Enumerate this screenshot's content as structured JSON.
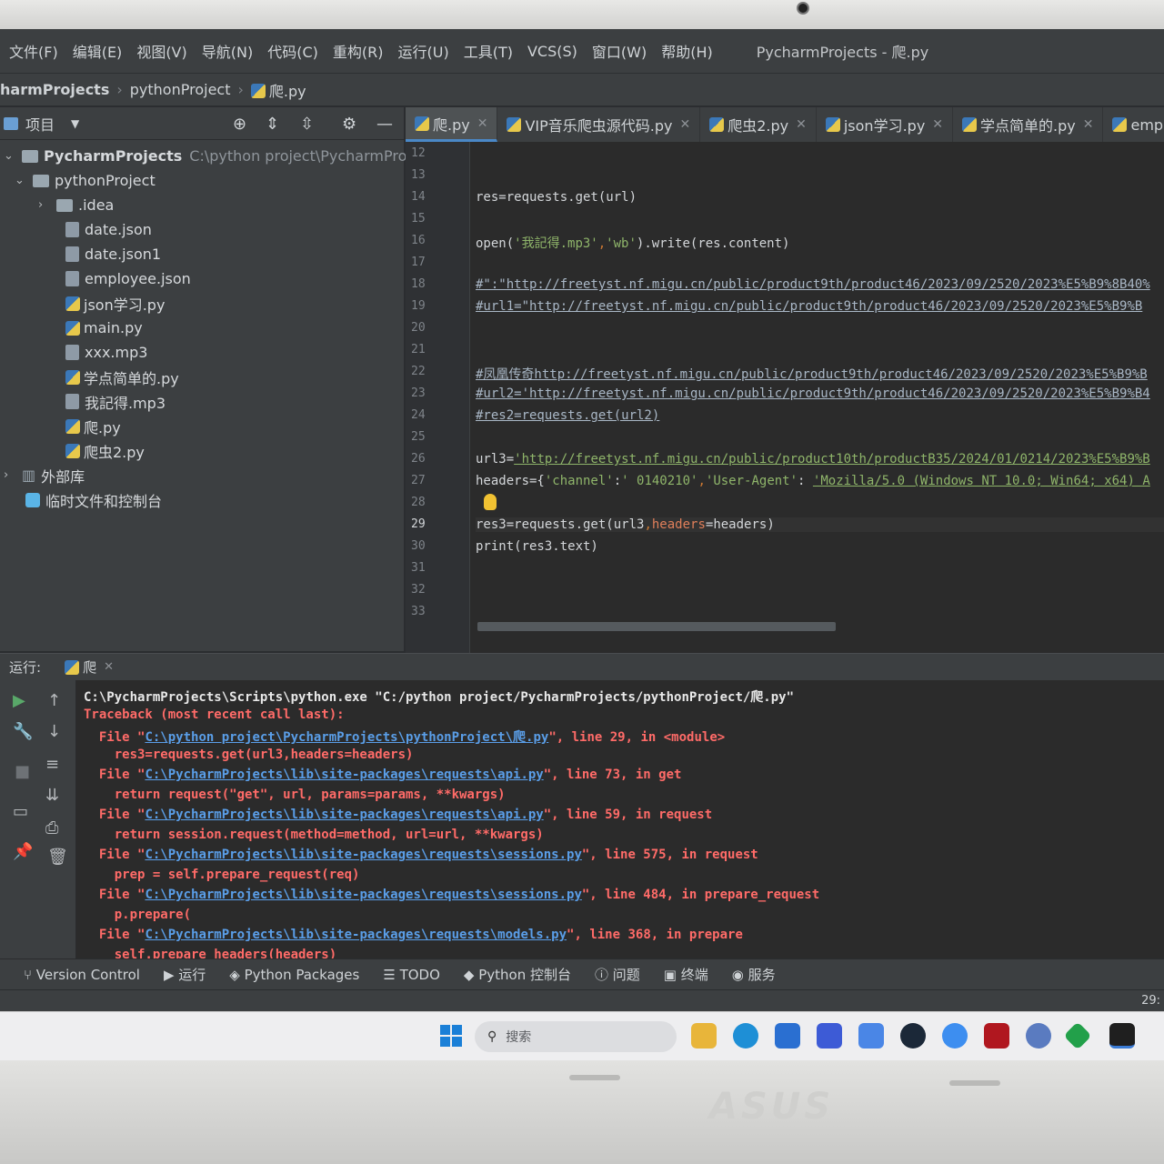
{
  "menu": {
    "items": [
      "文件(F)",
      "编辑(E)",
      "视图(V)",
      "导航(N)",
      "代码(C)",
      "重构(R)",
      "运行(U)",
      "工具(T)",
      "VCS(S)",
      "窗口(W)",
      "帮助(H)"
    ],
    "window_title": "PycharmProjects - 爬.py"
  },
  "breadcrumb": [
    "harmProjects",
    "pythonProject",
    "爬.py"
  ],
  "project_panel": {
    "title": "项目",
    "root_name": "PycharmProjects",
    "root_path": "C:\\python project\\PycharmProjects",
    "folder": "pythonProject",
    "subfolder": ".idea",
    "files": [
      "date.json",
      "date.json1",
      "employee.json",
      "json学习.py",
      "main.py",
      "xxx.mp3",
      "学点简单的.py",
      "我記得.mp3",
      "爬.py",
      "爬虫2.py"
    ],
    "external_libs": "外部库",
    "scratches": "临时文件和控制台"
  },
  "editor_tabs": [
    "爬.py",
    "VIP音乐爬虫源代码.py",
    "爬虫2.py",
    "json学习.py",
    "学点简单的.py",
    "employ"
  ],
  "line_numbers": [
    "12",
    "13",
    "14",
    "15",
    "16",
    "17",
    "18",
    "19",
    "20",
    "21",
    "22",
    "23",
    "24",
    "25",
    "26",
    "27",
    "28",
    "29",
    "30",
    "31",
    "32",
    "33"
  ],
  "current_line": "29",
  "code": {
    "l14": "res=requests.get(url)",
    "l16a": "open(",
    "l16b": "'我記得.mp3'",
    "l16c": ",",
    "l16d": "'wb'",
    "l16e": ").write(res.content)",
    "l18": "#\":\"http://freetyst.nf.migu.cn/public/product9th/product46/2023/09/2520/2023%E5%B9%8B40%",
    "l19": "#url1=\"http://freetyst.nf.migu.cn/public/product9th/product46/2023/09/2520/2023%E5%B9%B",
    "l22": "#凤凰传奇http://freetyst.nf.migu.cn/public/product9th/product46/2023/09/2520/2023%E5%B9%B",
    "l23": "#url2='http://freetyst.nf.migu.cn/public/product9th/product46/2023/09/2520/2023%E5%B9%B4",
    "l24": "#res2=requests.get(url2)",
    "l26a": "url3=",
    "l26b": "'http://freetyst.nf.migu.cn/public/product10th/productB35/2024/01/0214/2023%E5%B9%B",
    "l27a": "headers={",
    "l27b": "'channel'",
    "l27c": ":",
    "l27d": "' 0140210'",
    "l27e": ",",
    "l27f": "'User-Agent'",
    "l27g": ": ",
    "l27h": "'Mozilla/5.0 (Windows NT 10.0; Win64; x64) A",
    "l29a": "res3=requests.get(url3",
    "l29b": ",",
    "l29c": "headers",
    "l29d": "=headers)",
    "l30": "print(res3.text)"
  },
  "run_panel": {
    "label": "运行:",
    "tab": "爬",
    "lines": [
      {
        "kind": "plain",
        "text": "C:\\PycharmProjects\\Scripts\\python.exe \"C:/python project/PycharmProjects/pythonProject/爬.py\""
      },
      {
        "kind": "err",
        "text": "Traceback (most recent call last):"
      },
      {
        "kind": "file",
        "pre": "  File \"",
        "link": "C:\\python project\\PycharmProjects\\pythonProject\\爬.py",
        "post": "\", line 29, in <module>"
      },
      {
        "kind": "err",
        "text": "    res3=requests.get(url3,headers=headers)"
      },
      {
        "kind": "file",
        "pre": "  File \"",
        "link": "C:\\PycharmProjects\\lib\\site-packages\\requests\\api.py",
        "post": "\", line 73, in get"
      },
      {
        "kind": "err",
        "text": "    return request(\"get\", url, params=params, **kwargs)"
      },
      {
        "kind": "file",
        "pre": "  File \"",
        "link": "C:\\PycharmProjects\\lib\\site-packages\\requests\\api.py",
        "post": "\", line 59, in request"
      },
      {
        "kind": "err",
        "text": "    return session.request(method=method, url=url, **kwargs)"
      },
      {
        "kind": "file",
        "pre": "  File \"",
        "link": "C:\\PycharmProjects\\lib\\site-packages\\requests\\sessions.py",
        "post": "\", line 575, in request"
      },
      {
        "kind": "err",
        "text": "    prep = self.prepare_request(req)"
      },
      {
        "kind": "file",
        "pre": "  File \"",
        "link": "C:\\PycharmProjects\\lib\\site-packages\\requests\\sessions.py",
        "post": "\", line 484, in prepare_request"
      },
      {
        "kind": "err",
        "text": "    p.prepare("
      },
      {
        "kind": "file",
        "pre": "  File \"",
        "link": "C:\\PycharmProjects\\lib\\site-packages\\requests\\models.py",
        "post": "\", line 368, in prepare"
      },
      {
        "kind": "err",
        "text": "    self.prepare_headers(headers)"
      }
    ]
  },
  "bottom_tools": [
    "Version Control",
    "运行",
    "Python Packages",
    "TODO",
    "Python 控制台",
    "问题",
    "终端",
    "服务"
  ],
  "status_right": "29:",
  "taskbar": {
    "search_placeholder": "搜索"
  },
  "laptop_brand": "ASUS",
  "colors": {
    "accent": "#4a88c7",
    "error": "#ff6b68",
    "link": "#5a9ee8",
    "comment": "#a9b7c6",
    "bg": "#2b2b2b"
  }
}
